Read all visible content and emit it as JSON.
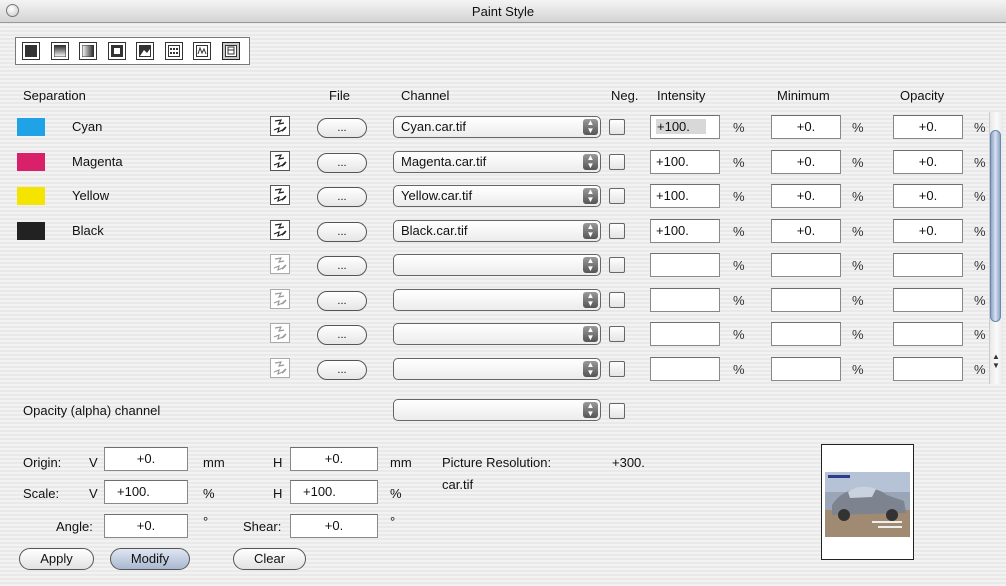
{
  "window": {
    "title": "Paint Style"
  },
  "toolbar": {
    "tools": [
      {
        "icon": "solid-fill-icon"
      },
      {
        "icon": "gradient-top-icon"
      },
      {
        "icon": "gradient-linear-icon"
      },
      {
        "icon": "gradient-radial-icon"
      },
      {
        "icon": "image-fill-icon"
      },
      {
        "icon": "pattern-fill-icon"
      },
      {
        "icon": "waveform-icon"
      },
      {
        "icon": "separation-picture-icon"
      }
    ],
    "selected_index": 7
  },
  "headers": {
    "separation": "Separation",
    "file": "File",
    "channel": "Channel",
    "neg": "Neg.",
    "intensity": "Intensity",
    "minimum": "Minimum",
    "opacity": "Opacity"
  },
  "rows": [
    {
      "name": "Cyan",
      "color": "#1fa3e6",
      "channel": "Cyan.car.tif",
      "intensity": "+100.",
      "minimum": "+0.",
      "opacity": "+0.",
      "file_btn": "...",
      "pct": "%"
    },
    {
      "name": "Magenta",
      "color": "#d9216b",
      "channel": "Magenta.car.tif",
      "intensity": "+100.",
      "minimum": "+0.",
      "opacity": "+0.",
      "file_btn": "...",
      "pct": "%"
    },
    {
      "name": "Yellow",
      "color": "#f5e400",
      "channel": "Yellow.car.tif",
      "intensity": "+100.",
      "minimum": "+0.",
      "opacity": "+0.",
      "file_btn": "...",
      "pct": "%"
    },
    {
      "name": "Black",
      "color": "#222222",
      "channel": "Black.car.tif",
      "intensity": "+100.",
      "minimum": "+0.",
      "opacity": "+0.",
      "file_btn": "...",
      "pct": "%"
    },
    {
      "name": "",
      "color": "",
      "channel": "",
      "intensity": "",
      "minimum": "",
      "opacity": "",
      "file_btn": "...",
      "pct": "%"
    },
    {
      "name": "",
      "color": "",
      "channel": "",
      "intensity": "",
      "minimum": "",
      "opacity": "",
      "file_btn": "...",
      "pct": "%"
    },
    {
      "name": "",
      "color": "",
      "channel": "",
      "intensity": "",
      "minimum": "",
      "opacity": "",
      "file_btn": "...",
      "pct": "%"
    },
    {
      "name": "",
      "color": "",
      "channel": "",
      "intensity": "",
      "minimum": "",
      "opacity": "",
      "file_btn": "...",
      "pct": "%"
    }
  ],
  "alpha": {
    "label": "Opacity (alpha) channel",
    "channel": ""
  },
  "transform": {
    "origin_label": "Origin:",
    "scale_label": "Scale:",
    "angle_label": "Angle:",
    "shear_label": "Shear:",
    "v_label": "V",
    "h_label": "H",
    "origin_v": "+0.",
    "origin_h": "+0.",
    "scale_v": "+100.",
    "scale_h": "+100.",
    "angle": "+0.",
    "shear": "+0.",
    "unit_mm": "mm",
    "unit_pct": "%",
    "unit_deg": "°"
  },
  "picture": {
    "resolution_label": "Picture Resolution:",
    "resolution_value": "+300.",
    "filename": "car.tif"
  },
  "buttons": {
    "apply": "Apply",
    "modify": "Modify",
    "clear": "Clear"
  }
}
